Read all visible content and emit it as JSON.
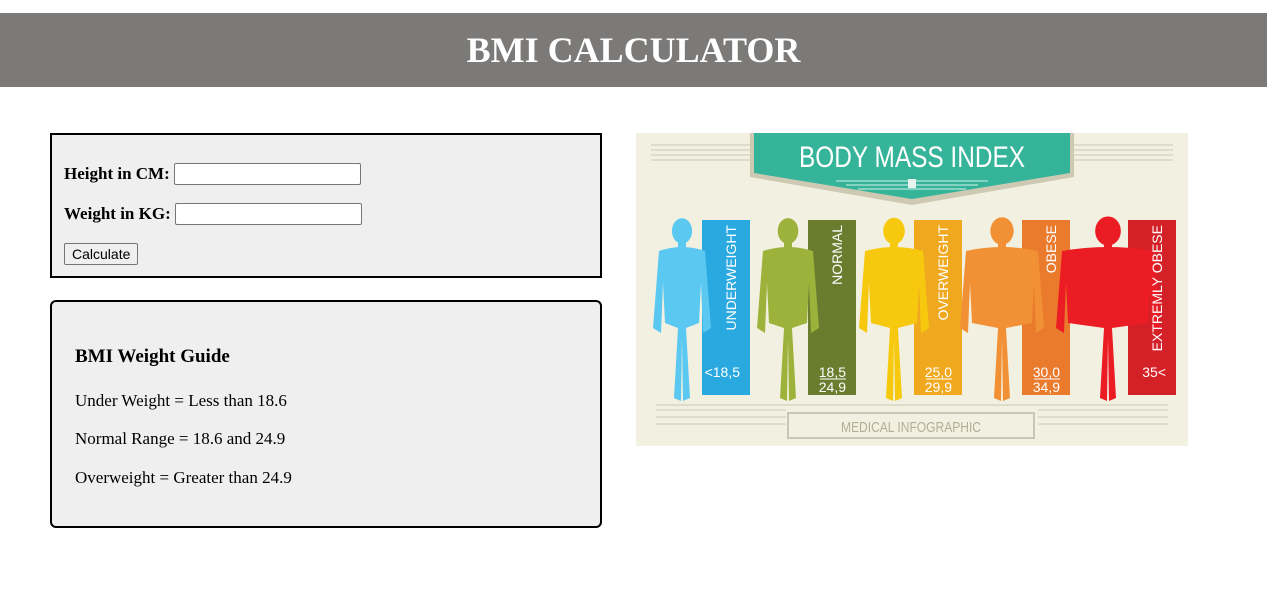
{
  "header": {
    "title": "BMI CALCULATOR"
  },
  "form": {
    "height_label": "Height in CM:",
    "height_value": "",
    "weight_label": "Weight in KG:",
    "weight_value": "",
    "calculate_label": "Calculate"
  },
  "guide": {
    "title": "BMI Weight Guide",
    "lines": [
      "Under Weight = Less than 18.6",
      "Normal Range = 18.6 and 24.9",
      "Overweight = Greater than 24.9"
    ]
  },
  "infographic": {
    "title": "BODY MASS INDEX",
    "footer": "MEDICAL INFOGRAPHIC",
    "categories": [
      {
        "label": "UNDERWEIGHT",
        "range_top": "<18,5",
        "range_bottom": "",
        "figure_color": "#5bc8f2",
        "bar_color": "#2aa9e0"
      },
      {
        "label": "NORMAL",
        "range_top": "18,5",
        "range_bottom": "24,9",
        "figure_color": "#9db23a",
        "bar_color": "#6a7d2f"
      },
      {
        "label": "OVERWEIGHT",
        "range_top": "25,0",
        "range_bottom": "29,9",
        "figure_color": "#f7c90e",
        "bar_color": "#f0a91f"
      },
      {
        "label": "OBESE",
        "range_top": "30,0",
        "range_bottom": "34,9",
        "figure_color": "#f29035",
        "bar_color": "#ea7a2c"
      },
      {
        "label": "EXTREMLY OBESE",
        "range_top": "35<",
        "range_bottom": "",
        "figure_color": "#ec1c24",
        "bar_color": "#d42027"
      }
    ]
  }
}
